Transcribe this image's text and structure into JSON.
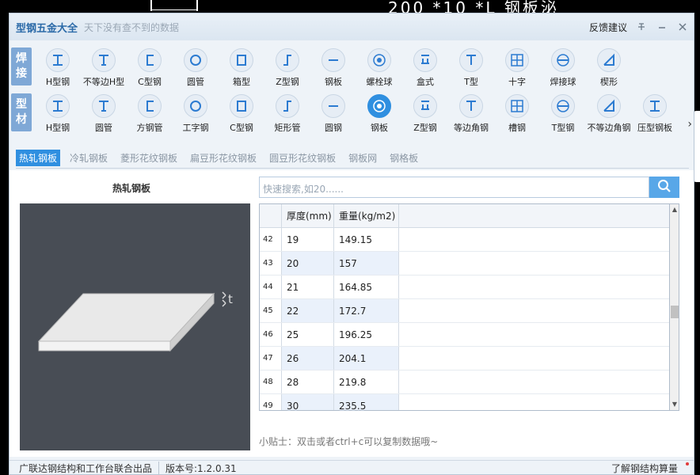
{
  "background": {
    "cad_text": "200 *10 *L 钢板泌"
  },
  "window": {
    "title": "型钢五金大全",
    "subtitle": "天下没有查不到的数据",
    "feedback": "反馈建议",
    "pin_icon": "pin-icon",
    "minimize_icon": "minimize-icon",
    "close_icon": "close-icon"
  },
  "categories": {
    "weld": {
      "label_lines": [
        "焊",
        "接"
      ],
      "items": [
        "H型钢",
        "不等边H型",
        "C型钢",
        "圆管",
        "箱型",
        "Z型钢",
        "钢板",
        "螺栓球",
        "盒式",
        "T型",
        "十字",
        "焊接球",
        "楔形"
      ]
    },
    "profile": {
      "label_lines": [
        "型",
        "材"
      ],
      "items": [
        "H型钢",
        "圆管",
        "方钢管",
        "工字钢",
        "C型钢",
        "矩形管",
        "圆钢",
        "钢板",
        "Z型钢",
        "等边角钢",
        "槽钢",
        "T型钢",
        "不等边角钢",
        "压型钢板"
      ],
      "active_index": 7
    }
  },
  "subtabs": {
    "items": [
      "热轧钢板",
      "冷轧钢板",
      "菱形花纹钢板",
      "扁豆形花纹钢板",
      "圆豆形花纹钢板",
      "钢板网",
      "钢格板"
    ],
    "active_index": 0
  },
  "main": {
    "section_title": "热轧钢板",
    "dimension_label": "t",
    "search_placeholder": "快速搜索,如20......",
    "table": {
      "headers": [
        "厚度(mm)",
        "重量(kg/m2)"
      ],
      "rows": [
        [
          "42",
          "19",
          "149.15"
        ],
        [
          "43",
          "20",
          "157"
        ],
        [
          "44",
          "21",
          "164.85"
        ],
        [
          "45",
          "22",
          "172.7"
        ],
        [
          "46",
          "25",
          "196.25"
        ],
        [
          "47",
          "26",
          "204.1"
        ],
        [
          "48",
          "28",
          "219.8"
        ],
        [
          "49",
          "30",
          "235.5"
        ]
      ]
    },
    "tip": "小贴士：双击或者ctrl+c可以复制数据哦~"
  },
  "footer": {
    "org": "广联达钢结构和工作台联合出品",
    "version": "版本号:1.2.0.31",
    "learn_more": "了解钢结构算量"
  }
}
